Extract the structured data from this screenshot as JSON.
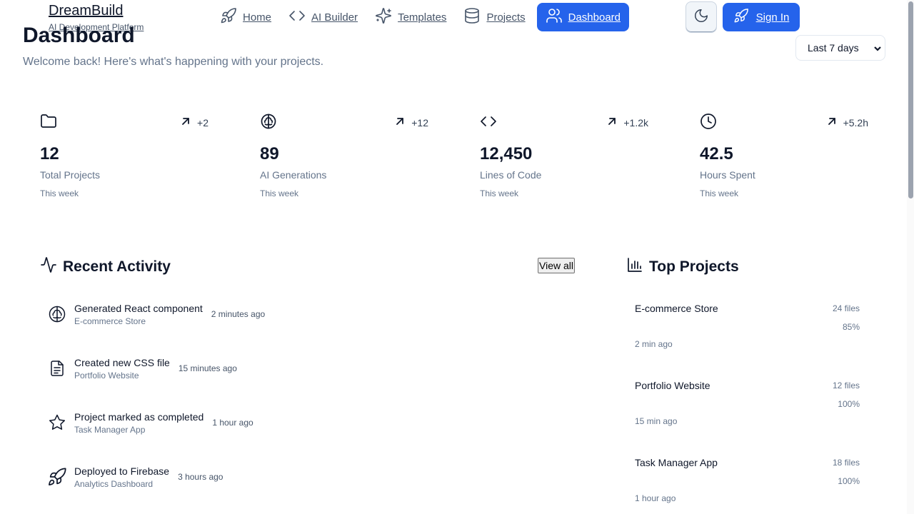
{
  "brand": {
    "name": "DreamBuild",
    "tagline": "AI Development Platform"
  },
  "nav": {
    "items": [
      {
        "label": "Home",
        "icon": "rocket-icon"
      },
      {
        "label": "AI Builder",
        "icon": "code-icon"
      },
      {
        "label": "Templates",
        "icon": "sparkles-icon"
      },
      {
        "label": "Projects",
        "icon": "database-icon"
      },
      {
        "label": "Dashboard",
        "icon": "users-icon",
        "active": true
      }
    ],
    "theme_icon": "moon-icon",
    "signin_label": "Sign In",
    "accent_color": "#2563eb"
  },
  "page": {
    "title": "Dashboard",
    "subtitle": "Welcome back! Here's what's happening with your projects.",
    "range_selected": "Last 7 days"
  },
  "stats": [
    {
      "icon": "folder-icon",
      "delta": "+2",
      "value": "12",
      "label": "Total Projects",
      "period": "This week"
    },
    {
      "icon": "brain-icon",
      "delta": "+12",
      "value": "89",
      "label": "AI Generations",
      "period": "This week"
    },
    {
      "icon": "code-icon",
      "delta": "+1.2k",
      "value": "12,450",
      "label": "Lines of Code",
      "period": "This week"
    },
    {
      "icon": "clock-icon",
      "delta": "+5.2h",
      "value": "42.5",
      "label": "Hours Spent",
      "period": "This week"
    }
  ],
  "activity": {
    "title": "Recent Activity",
    "view_all_label": "View all",
    "items": [
      {
        "icon": "brain-icon",
        "title": "Generated React component",
        "project": "E-commerce Store",
        "time": "2 minutes ago"
      },
      {
        "icon": "file-text-icon",
        "title": "Created new CSS file",
        "project": "Portfolio Website",
        "time": "15 minutes ago"
      },
      {
        "icon": "star-icon",
        "title": "Project marked as completed",
        "project": "Task Manager App",
        "time": "1 hour ago"
      },
      {
        "icon": "rocket-icon",
        "title": "Deployed to Firebase",
        "project": "Analytics Dashboard",
        "time": "3 hours ago"
      }
    ]
  },
  "top_projects": {
    "title": "Top Projects",
    "items": [
      {
        "name": "E-commerce Store",
        "files": "24 files",
        "progress": "85%",
        "time": "2 min ago"
      },
      {
        "name": "Portfolio Website",
        "files": "12 files",
        "progress": "100%",
        "time": "15 min ago"
      },
      {
        "name": "Task Manager App",
        "files": "18 files",
        "progress": "100%",
        "time": "1 hour ago"
      }
    ]
  }
}
